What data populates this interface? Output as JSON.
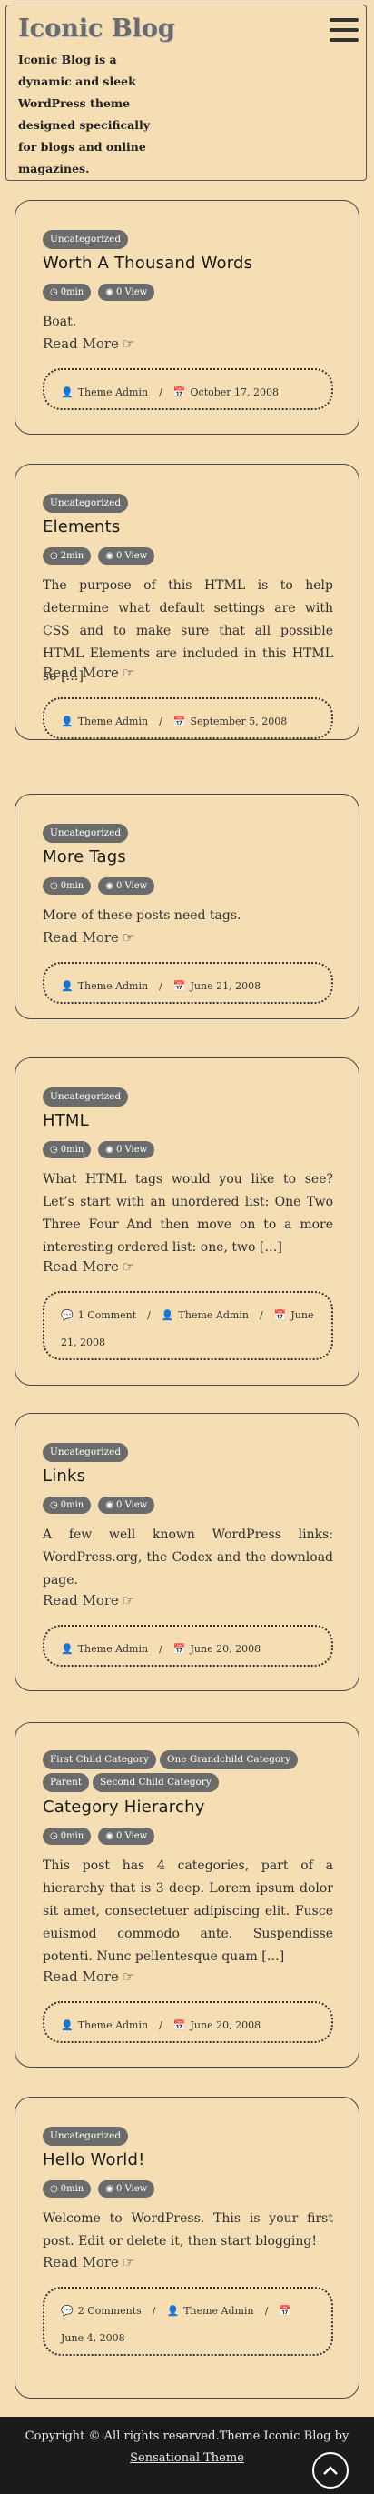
{
  "site": {
    "title": "Iconic Blog",
    "tagline": "Iconic Blog is a dynamic and sleek WordPress theme designed specifically for blogs and online magazines."
  },
  "posts": [
    {
      "categories": [
        "Uncategorized"
      ],
      "title": "Worth A Thousand Words",
      "read_time": "0min",
      "views": "0 View",
      "excerpt": "Boat.",
      "read_more": "Read More",
      "comments": "",
      "author": "Theme Admin",
      "date": "October 17, 2008"
    },
    {
      "categories": [
        "Uncategorized"
      ],
      "title": "Elements",
      "read_time": "2min",
      "views": "0 View",
      "excerpt": "The purpose of this HTML is to help determine what default settings are with CSS and to make sure that all possible HTML Elements are included in this HTML so […]",
      "read_more": "Read More",
      "comments": "",
      "author": "Theme Admin",
      "date": "September 5, 2008"
    },
    {
      "categories": [
        "Uncategorized"
      ],
      "title": "More Tags",
      "read_time": "0min",
      "views": "0 View",
      "excerpt": "More of these posts need tags.",
      "read_more": "Read More",
      "comments": "",
      "author": "Theme Admin",
      "date": "June 21, 2008"
    },
    {
      "categories": [
        "Uncategorized"
      ],
      "title": "HTML",
      "read_time": "0min",
      "views": "0 View",
      "excerpt": "What HTML tags would you like to see? Let’s start with an unordered list: One Two Three Four And then move on to a more interesting ordered list: one, two […]",
      "read_more": "Read More",
      "comments": "1 Comment",
      "author": "Theme Admin",
      "date": "June 21, 2008"
    },
    {
      "categories": [
        "Uncategorized"
      ],
      "title": "Links",
      "read_time": "0min",
      "views": "0 View",
      "excerpt": "A few well known WordPress links: WordPress.org, the Codex and the download page.",
      "read_more": "Read More",
      "comments": "",
      "author": "Theme Admin",
      "date": "June 20, 2008"
    },
    {
      "categories": [
        "First Child Category",
        "One Grandchild Category",
        "Parent",
        "Second Child Category"
      ],
      "title": "Category Hierarchy",
      "read_time": "0min",
      "views": "0 View",
      "excerpt": "This post has 4 categories, part of a hierarchy that is 3 deep. Lorem ipsum dolor sit amet, consectetuer adipiscing elit. Fusce euismod commodo ante. Suspendisse potenti. Nunc pellentesque quam […]",
      "read_more": "Read More",
      "comments": "",
      "author": "Theme Admin",
      "date": "June 20, 2008"
    },
    {
      "categories": [
        "Uncategorized"
      ],
      "title": "Hello World!",
      "read_time": "0min",
      "views": "0 View",
      "excerpt": "Welcome to WordPress. This is your first post. Edit or delete it, then start blogging!",
      "read_more": "Read More",
      "comments": "2 Comments",
      "author": "Theme Admin",
      "date": "June 4, 2008"
    }
  ],
  "footer": {
    "copyright": "Copyright © All rights reserved.Theme Iconic Blog by",
    "credit_link": "Sensational Theme"
  },
  "icons": {
    "menu": "hamburger-icon",
    "clock": "clock-icon",
    "eye": "eye-icon",
    "hand": "hand-pointing-right-icon",
    "user": "user-icon",
    "calendar": "calendar-icon",
    "comment": "comment-icon",
    "back_to_top": "chevron-up-icon"
  }
}
